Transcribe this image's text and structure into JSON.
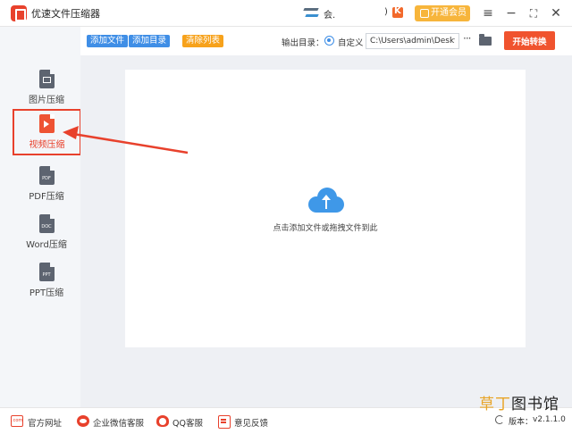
{
  "window": {
    "title": "优速文件压缩器",
    "user_name": "会.",
    "user_extra": ")",
    "vip_button": "开通会员",
    "menu_icon": "hamburger-menu-icon",
    "min_icon": "minimize-icon",
    "max_icon": "maximize-icon",
    "close_icon": "close-icon"
  },
  "toolbar": {
    "add_file": "添加文件",
    "add_dir": "添加目录",
    "clear_list": "清除列表",
    "output_label": "输出目录：",
    "radio_custom": "自定义",
    "output_path": "C:\\Users\\admin\\Deskto",
    "more": "···",
    "start": "开始转换"
  },
  "sidebar": {
    "items": [
      {
        "label": "图片压缩",
        "icon": "image-file-icon"
      },
      {
        "label": "视频压缩",
        "icon": "video-file-icon",
        "active": true
      },
      {
        "label": "PDF压缩",
        "icon": "pdf-file-icon",
        "tag": "PDF"
      },
      {
        "label": "Word压缩",
        "icon": "doc-file-icon",
        "tag": "DOC"
      },
      {
        "label": "PPT压缩",
        "icon": "ppt-file-icon",
        "tag": "PPT"
      }
    ]
  },
  "main": {
    "drop_hint": "点击添加文件或拖拽文件到此"
  },
  "footer": {
    "website": "官方网址",
    "wechat": "企业微信客服",
    "qq": "QQ客服",
    "feedback": "意见反馈",
    "version_label": "版本：",
    "version_value": "v2.1.1.0"
  },
  "watermark": {
    "part1": "草丁",
    "part2": "图书馆"
  },
  "colors": {
    "accent_red": "#e8412c",
    "button_blue": "#3f8ee6",
    "button_orange": "#f7a21b",
    "start_button": "#f0532e",
    "cloud_blue": "#3f98e8"
  }
}
